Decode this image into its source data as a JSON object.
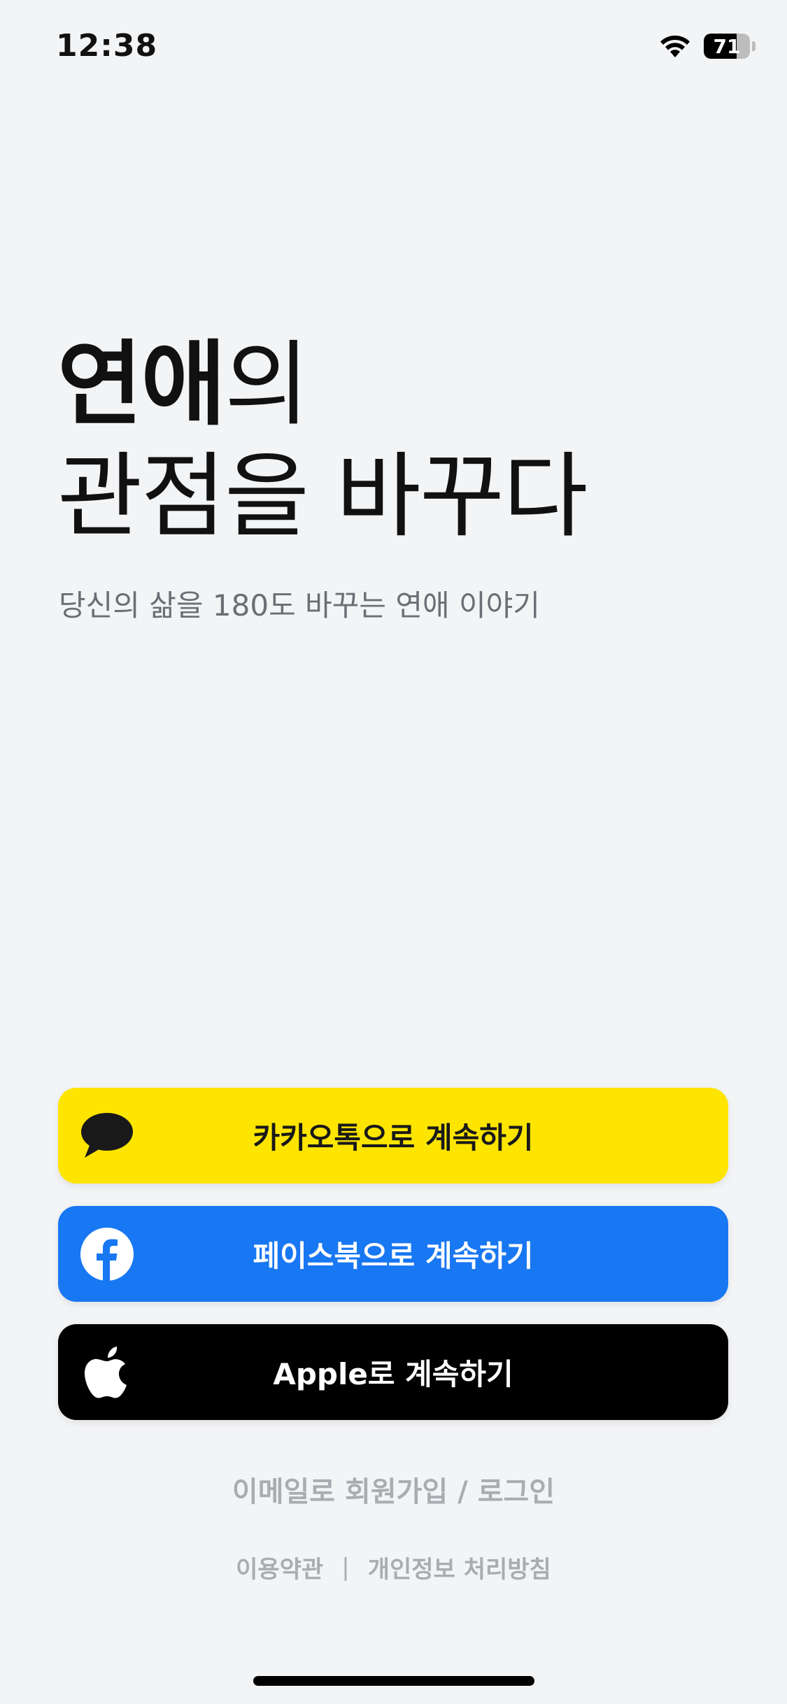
{
  "status_bar": {
    "time": "12:38",
    "battery_level": "71",
    "battery_fraction": 0.71,
    "wifi_icon": "wifi-icon",
    "battery_icon": "battery-icon"
  },
  "hero": {
    "title_bold": "연애",
    "title_rest_line1": "의",
    "title_line2": "관점을 바꾸다",
    "subtitle": "당신의 삶을 180도 바꾸는 연애 이야기"
  },
  "buttons": {
    "kakao": {
      "label": "카카오톡으로 계속하기",
      "icon": "kakao-talk-icon",
      "color": "#FEE500"
    },
    "facebook": {
      "label": "페이스북으로 계속하기",
      "icon": "facebook-icon",
      "color": "#1877F2"
    },
    "apple": {
      "label": "Apple로 계속하기",
      "icon": "apple-icon",
      "color": "#000000"
    }
  },
  "links": {
    "email": "이메일로 회원가입 / 로그인",
    "terms": "이용약관",
    "divider": "|",
    "privacy": "개인정보 처리방침"
  }
}
